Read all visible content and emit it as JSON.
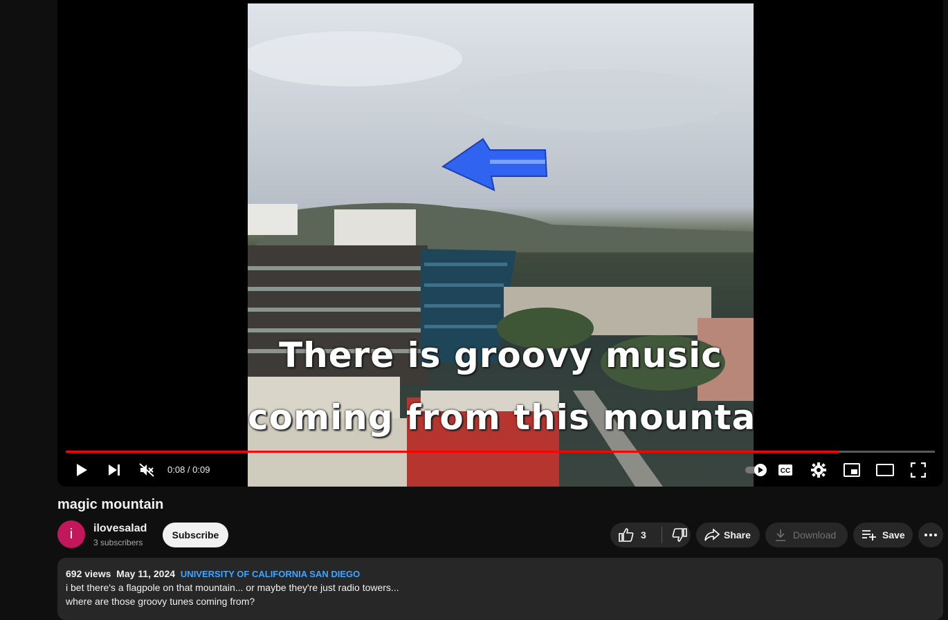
{
  "video": {
    "overlay_line1": "There is groovy music",
    "overlay_line2": "coming from this mountain",
    "progress": 0.889
  },
  "controls": {
    "time": "0:08 / 0:09",
    "icons": [
      "play-icon",
      "next-icon",
      "volume-muted-icon",
      "autoplay-toggle-icon",
      "captions-icon",
      "settings-icon",
      "miniplayer-icon",
      "theater-mode-icon",
      "fullscreen-icon"
    ],
    "cc_label": "CC"
  },
  "info": {
    "title": "magic mountain",
    "avatar_letter": "i",
    "channel_name": "ilovesalad",
    "subscribers": "3 subscribers",
    "subscribe_label": "Subscribe",
    "like_count": "3",
    "share_label": "Share",
    "download_label": "Download",
    "save_label": "Save"
  },
  "description": {
    "views": "692 views",
    "date": "May 11, 2024",
    "location": "UNIVERSITY OF CALIFORNIA SAN DIEGO",
    "line1": "i bet there's a flagpole on that mountain... or maybe they're just radio towers...",
    "line2": "where are those groovy tunes coming from?"
  },
  "colors": {
    "background": "#0f0f0f",
    "progress_red": "#ff0000",
    "pill_bg": "#272727",
    "avatar_bg": "#c2185b",
    "link_blue": "#3ea6ff"
  }
}
